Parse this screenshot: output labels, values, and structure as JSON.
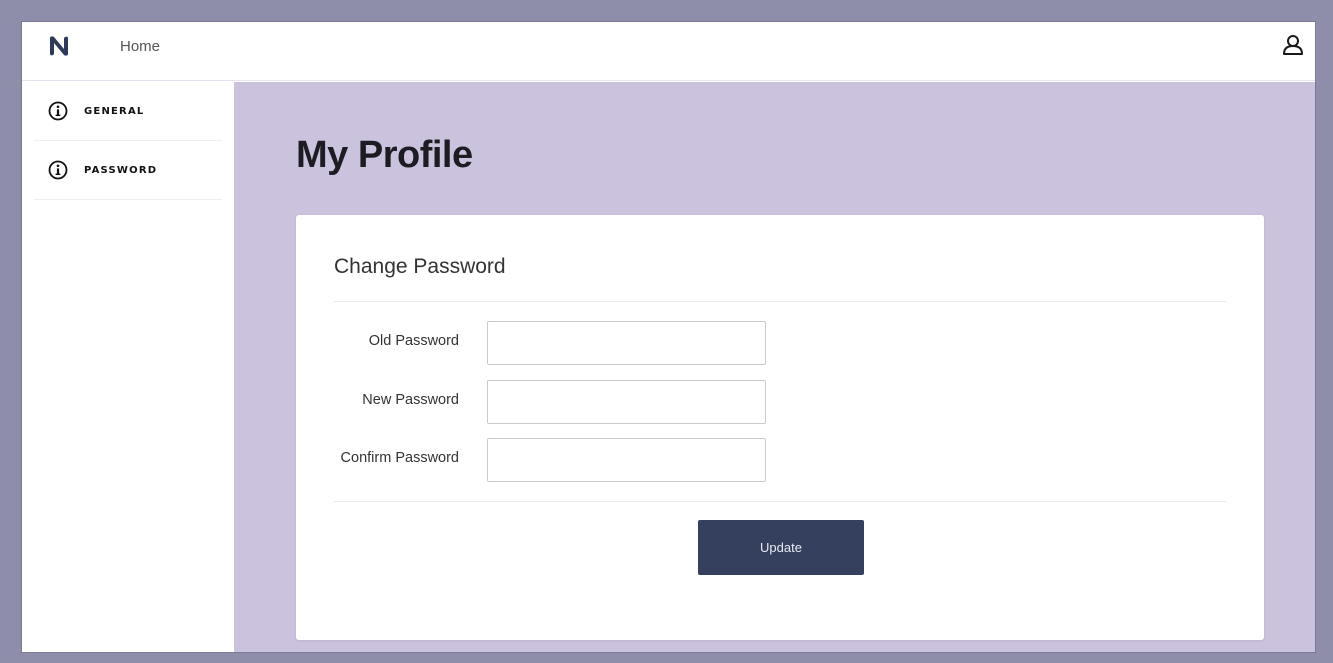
{
  "topbar": {
    "logo_icon": "brand-logo-icon",
    "home_label": "Home",
    "user_icon": "user-icon"
  },
  "sidebar": {
    "items": [
      {
        "label": "GENERAL",
        "icon": "info-icon"
      },
      {
        "label": "PASSWORD",
        "icon": "info-icon"
      }
    ]
  },
  "main": {
    "title": "My Profile",
    "card": {
      "title": "Change Password",
      "fields": [
        {
          "label": "Old Password",
          "value": "",
          "placeholder": ""
        },
        {
          "label": "New Password",
          "value": "",
          "placeholder": ""
        },
        {
          "label": "Confirm Password",
          "value": "",
          "placeholder": ""
        }
      ],
      "submit_label": "Update"
    }
  },
  "colors": {
    "background_accent": "#cbc3de",
    "button": "#34405e",
    "logo": "#2d3a5c",
    "outer_frame": "#8e8eaa"
  }
}
